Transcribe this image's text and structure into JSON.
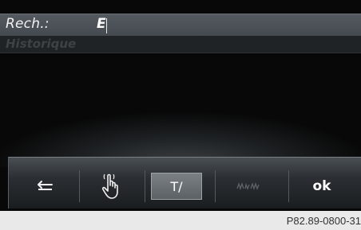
{
  "search": {
    "label": "Rech.:",
    "value": "E"
  },
  "history": {
    "label": "Historique"
  },
  "toolbar": {
    "back_icon": "back-arrow-icon",
    "handwriting_icon": "handwriting-hand-icon",
    "text_mode_label": "T/",
    "scribble_icon": "scribble-icon",
    "ok_label": "ok"
  },
  "footer": {
    "reference": "P82.89-0800-31"
  },
  "colors": {
    "screen_background": "#080808",
    "search_row": "#4c5258",
    "active_button": "#6a6f74",
    "footer": "#e9e9e9"
  }
}
